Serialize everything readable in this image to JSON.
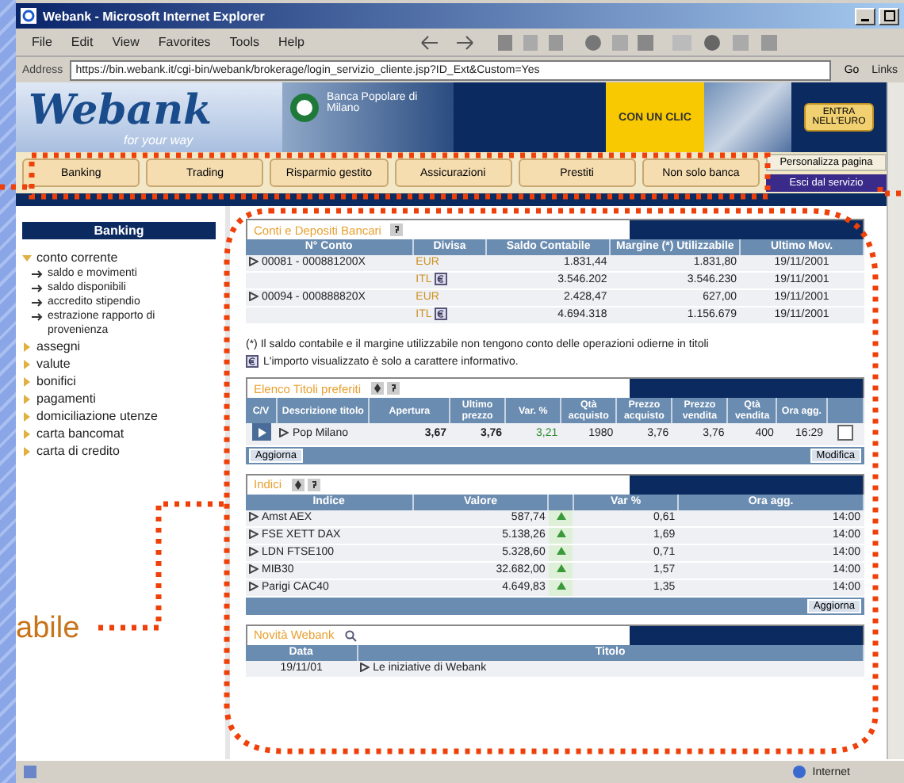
{
  "window": {
    "title": "Webank - Microsoft Internet Explorer"
  },
  "menu": [
    "File",
    "Edit",
    "View",
    "Favorites",
    "Tools",
    "Help"
  ],
  "address_bar": {
    "label": "Address",
    "url": "https://bin.webank.it/cgi-bin/webank/brokerage/login_servizio_cliente.jsp?ID_Ext&Custom=Yes",
    "go": "Go",
    "links": "Links"
  },
  "banner": {
    "logo": "Webank",
    "tagline": "for your way",
    "bank": "Banca Popolare di Milano",
    "promo": "CON UN CLIC",
    "euro": "ENTRA NELL'EURO"
  },
  "nav": [
    "Banking",
    "Trading",
    "Risparmio gestito",
    "Assicurazioni",
    "Prestiti",
    "Non solo banca"
  ],
  "nav_side": [
    "Personalizza pagina",
    "Esci dal servizio"
  ],
  "sidebar": {
    "title": "Banking",
    "items": [
      {
        "label": "conto corrente",
        "expanded": true,
        "children": [
          {
            "label": "saldo e movimenti"
          },
          {
            "label": "saldo disponibili"
          },
          {
            "label": "accredito stipendio"
          },
          {
            "label": "estrazione rapporto di provenienza"
          }
        ]
      },
      {
        "label": "assegni",
        "expanded": false
      },
      {
        "label": "valute",
        "expanded": false
      },
      {
        "label": "bonifici",
        "expanded": false
      },
      {
        "label": "pagamenti",
        "expanded": false
      },
      {
        "label": "domiciliazione utenze",
        "expanded": false
      },
      {
        "label": "carta bancomat",
        "expanded": false
      },
      {
        "label": "carta di credito",
        "expanded": false
      }
    ]
  },
  "accounts": {
    "title": "Conti e Depositi Bancari",
    "columns": [
      "N° Conto",
      "Divisa",
      "Saldo Contabile",
      "Margine (*) Utilizzabile",
      "Ultimo Mov."
    ],
    "rows": [
      {
        "account": "00081 - 000881200X",
        "currency": "EUR",
        "balance": "1.831,44",
        "available": "1.831,80",
        "date": "19/11/2001"
      },
      {
        "currency": "ITL",
        "balance": "3.546.202",
        "available": "3.546.230",
        "date": "19/11/2001"
      },
      {
        "account": "00094 - 000888820X",
        "currency": "EUR",
        "balance": "2.428,47",
        "available": "627,00",
        "date": "19/11/2001"
      },
      {
        "currency": "ITL",
        "balance": "4.694.318",
        "available": "1.156.679",
        "date": "19/11/2001"
      }
    ]
  },
  "footnotes": [
    "(*) Il saldo contabile e il margine utilizzabile non tengono conto delle operazioni odierne in titoli",
    "L'importo visualizzato è solo a carattere informativo."
  ],
  "favorites": {
    "title": "Elenco Titoli preferiti",
    "columns": [
      "C/V",
      "Descrizione titolo",
      "Apertura",
      "Ultimo prezzo",
      "Var. %",
      "Qtà acquisto",
      "Prezzo acquisto",
      "Prezzo vendita",
      "Qtà vendita",
      "Ora agg."
    ],
    "rows": [
      {
        "name": "Pop Milano",
        "open": "3,67",
        "last": "3,76",
        "change": "3,21",
        "bid_qty": "1980",
        "bid": "3,76",
        "ask": "3,76",
        "ask_qty": "400",
        "time": "16:29",
        "checked": false
      }
    ],
    "buttons": [
      "Aggiorna",
      "Modifica"
    ]
  },
  "indices": {
    "title": "Indici",
    "columns": [
      "Indice",
      "Valore",
      "Var %",
      "Ora agg."
    ],
    "rows": [
      {
        "name": "Amst AEX",
        "value": "587,74",
        "change": "0,61",
        "time": "14:00"
      },
      {
        "name": "FSE XETT DAX",
        "value": "5.138,26",
        "change": "1,69",
        "time": "14:00"
      },
      {
        "name": "LDN FTSE100",
        "value": "5.328,60",
        "change": "0,71",
        "time": "14:00"
      },
      {
        "name": "MIB30",
        "value": "32.682,00",
        "change": "1,57",
        "time": "14:00"
      },
      {
        "name": "Parigi CAC40",
        "value": "4.649,83",
        "change": "1,35",
        "time": "14:00"
      }
    ],
    "button": "Aggiorna"
  },
  "news": {
    "title": "Novità Webank",
    "columns": [
      "Data",
      "Titolo"
    ],
    "rows": [
      {
        "date": "19/11/01",
        "title": "Le iniziative di Webank"
      }
    ]
  },
  "status_bar": {
    "zone": "Internet"
  },
  "annotation": {
    "label": "abile"
  }
}
